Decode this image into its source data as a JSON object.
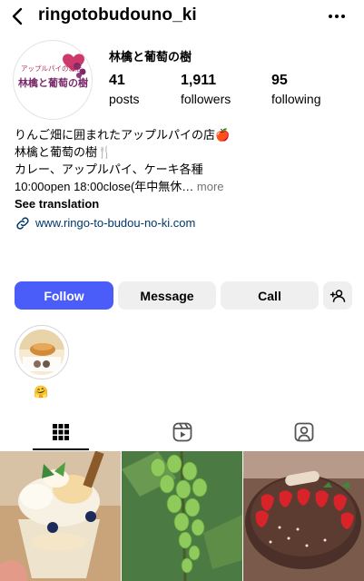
{
  "header": {
    "username": "ringotobudouno_ki",
    "back_icon": "back-arrow-icon",
    "more_icon": "more-horizontal-icon"
  },
  "profile": {
    "avatar_text": "アップルパイのお店",
    "avatar_title": "林檎と葡萄の樹",
    "display_name": "林檎と葡萄の樹",
    "stats": {
      "posts_count": "41",
      "posts_label": "posts",
      "followers_count": "1,911",
      "followers_label": "followers",
      "following_count": "95",
      "following_label": "following"
    }
  },
  "bio": {
    "line1": "りんご畑に囲まれたアップルパイの店🍎",
    "line2": "林檎と葡萄の樹🍴",
    "line3": "カレー、アップルパイ、ケーキ各種",
    "line4": "10:00open 18:00close(年中無休…",
    "more_label": "more",
    "see_translation": "See translation",
    "link_url": "www.ringo-to-budou-no-ki.com",
    "link_icon": "link-icon"
  },
  "actions": {
    "follow_label": "Follow",
    "message_label": "Message",
    "call_label": "Call",
    "suggest_icon": "add-person-icon"
  },
  "highlights": [
    {
      "emoji": "🤗"
    }
  ],
  "tabs": [
    {
      "name": "posts-grid",
      "icon": "grid-icon",
      "active": true
    },
    {
      "name": "reels",
      "icon": "reels-icon",
      "active": false
    },
    {
      "name": "tagged",
      "icon": "tagged-person-icon",
      "active": false
    }
  ],
  "grid": [
    {
      "description": "parfait",
      "alt": ""
    },
    {
      "description": "green grapes",
      "alt": ""
    },
    {
      "description": "chocolate cake with strawberries",
      "alt": ""
    }
  ],
  "colors": {
    "follow_button": "#4a5df9",
    "secondary_button": "#efefef",
    "link": "#00376b",
    "muted": "#737373"
  }
}
